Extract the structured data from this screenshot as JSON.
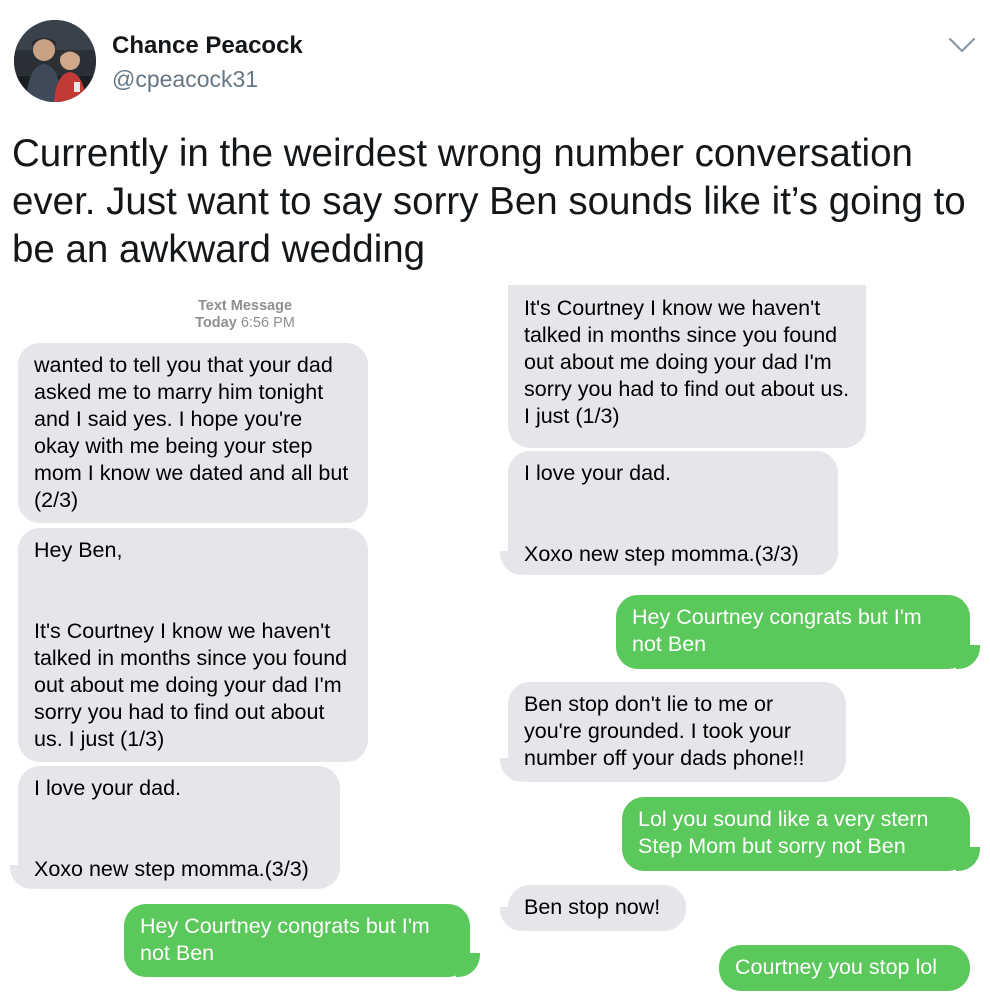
{
  "tweet": {
    "author_name": "Chance Peacock",
    "author_handle": "@cpeacock31",
    "text": "Currently in the weirdest wrong number conversation ever. Just want to say sorry Ben sounds like it’s going to be an awkward wedding",
    "menu_icon": "chevron-down-icon"
  },
  "left_screenshot": {
    "timestamp_label": "Text Message",
    "timestamp_day": "Today",
    "timestamp_time": "6:56 PM",
    "messages": [
      {
        "from": "them",
        "text": "wanted to tell you that your dad asked me to marry him tonight and I said yes. I hope you're okay with me being your step mom I know we dated and all but (2/3)"
      },
      {
        "from": "them",
        "text": "Hey Ben,\n\n\nIt's Courtney I know we haven't talked in months since you found out about me doing your dad I'm sorry you had to find out about us. I just (1/3)"
      },
      {
        "from": "them",
        "text": "I love your dad.\n\n\nXoxo new step momma.(3/3)"
      },
      {
        "from": "me",
        "text": "Hey Courtney congrats but I'm not Ben"
      }
    ]
  },
  "right_screenshot": {
    "messages": [
      {
        "from": "them",
        "text": "It's Courtney I know we haven't talked in months since you found out about me doing your dad I'm sorry you had to find out about us. I just (1/3)"
      },
      {
        "from": "them",
        "text": "I love your dad.\n\n\nXoxo new step momma.(3/3)"
      },
      {
        "from": "me",
        "text": "Hey Courtney congrats but I'm not Ben"
      },
      {
        "from": "them",
        "text": "Ben stop don't lie to me or you're grounded. I took your number off your dads phone!!"
      },
      {
        "from": "me",
        "text": "Lol you sound like a very stern Step Mom but sorry not Ben"
      },
      {
        "from": "them",
        "text": "Ben stop now!"
      },
      {
        "from": "me",
        "text": "Courtney you stop lol"
      }
    ]
  },
  "colors": {
    "received_bubble": "#e5e5ea",
    "sent_bubble": "#5ac85a",
    "handle": "#657786"
  }
}
